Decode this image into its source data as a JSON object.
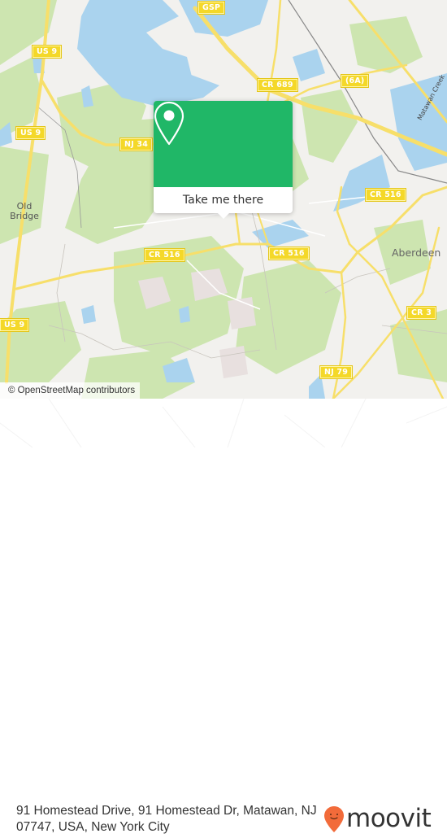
{
  "map": {
    "road_shields": [
      {
        "id": "gsp",
        "label": "GSP"
      },
      {
        "id": "us9-north",
        "label": "US 9"
      },
      {
        "id": "us9-mid",
        "label": "US 9"
      },
      {
        "id": "us9-south",
        "label": "US 9"
      },
      {
        "id": "nj34",
        "label": "NJ 34"
      },
      {
        "id": "cr689",
        "label": "CR 689"
      },
      {
        "id": "6a",
        "label": "(6A)"
      },
      {
        "id": "cr516-east",
        "label": "CR 516"
      },
      {
        "id": "cr516-west",
        "label": "CR 516"
      },
      {
        "id": "cr516-mid",
        "label": "CR 516"
      },
      {
        "id": "cr3",
        "label": "CR 3"
      },
      {
        "id": "nj79",
        "label": "NJ 79"
      }
    ],
    "places": [
      {
        "id": "old-bridge",
        "label": "Old\nBridge"
      },
      {
        "id": "aberdeen",
        "label": "Aberdeen"
      }
    ],
    "water_labels": [
      {
        "id": "matawan-creek",
        "label": "Matawan Creek"
      }
    ],
    "colors": {
      "land": "#f2f1ee",
      "forest": "#cde5b0",
      "water": "#aad3ee",
      "road": "#f7df6a",
      "rail": "#888888"
    },
    "attribution": "© OpenStreetMap contributors"
  },
  "popup": {
    "icon": "map-pin-icon",
    "button_label": "Take me there",
    "color": "#20b767"
  },
  "footer": {
    "address_line1": "91 Homestead Drive, 91 Homestead Dr, Matawan, NJ",
    "address_line2": "07747, USA, New York City",
    "brand": "moovit",
    "brand_color": "#f26b3a"
  }
}
